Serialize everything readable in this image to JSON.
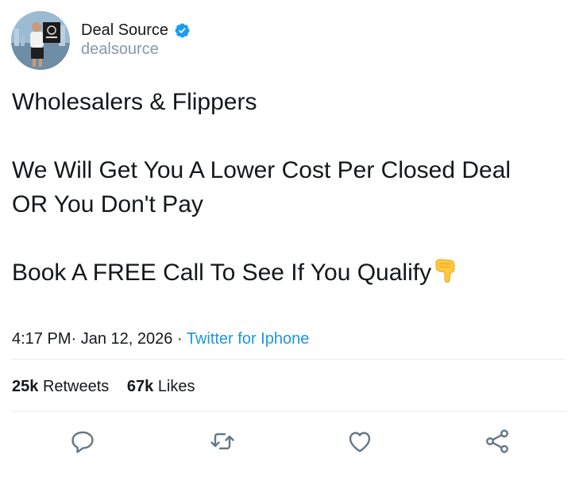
{
  "user": {
    "display_name": "Deal Source",
    "handle": "dealsource",
    "verified": true,
    "verified_color": "#1d9bf0"
  },
  "tweet": {
    "lines": [
      "Wholesalers & Flippers",
      "We Will Get You A Lower Cost Per Closed Deal",
      "OR You Don't Pay",
      "Book A FREE Call To See If You Qualify"
    ],
    "trailing_emoji": "backhand-index-pointing-down"
  },
  "meta": {
    "time": "4:17 PM",
    "date_sep": "·",
    "date": "Jan 12, 2026",
    "source_sep": "·",
    "source": "Twitter for Iphone"
  },
  "stats": {
    "retweets_count": "25k",
    "retweets_label": "Retweets",
    "likes_count": "67k",
    "likes_label": "Likes"
  },
  "actions": [
    "reply-icon",
    "retweet-icon",
    "like-icon",
    "share-icon"
  ],
  "colors": {
    "text": "#14171a",
    "muted": "#8899a6",
    "link": "#1b95e0",
    "divider": "#e6ecf0",
    "icon": "#657786"
  }
}
